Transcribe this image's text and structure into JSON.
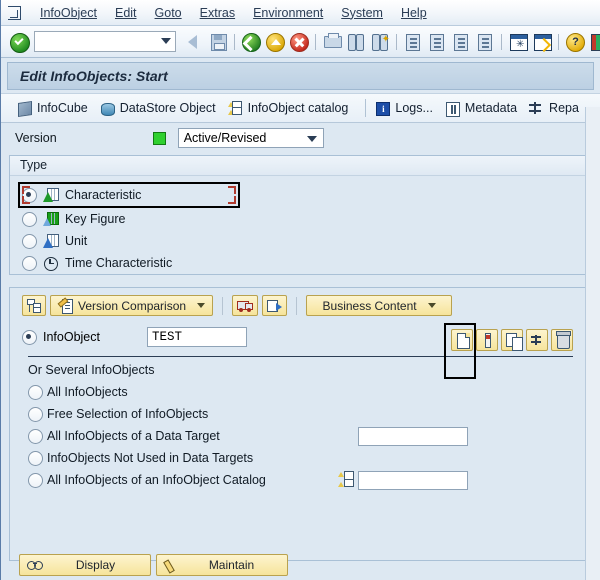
{
  "window": {
    "system_icon": "window-menu-icon"
  },
  "menubar": {
    "items": [
      {
        "label": "InfoObject",
        "accel_index": 0
      },
      {
        "label": "Edit",
        "accel_index": 0
      },
      {
        "label": "Goto",
        "accel_index": 0
      },
      {
        "label": "Extras",
        "accel_index": 4
      },
      {
        "label": "Environment",
        "accel_index": 2
      },
      {
        "label": "System",
        "accel_index": 1
      },
      {
        "label": "Help",
        "accel_index": 0
      }
    ]
  },
  "toolbar": {
    "command_field_value": "",
    "icons": [
      "enter-check-icon",
      "back-arrow-icon",
      "save-icon",
      "back-globe-icon",
      "exit-globe-icon",
      "cancel-globe-icon",
      "print-icon",
      "find-icon",
      "find-next-icon",
      "first-page-icon",
      "previous-page-icon",
      "next-page-icon",
      "last-page-icon",
      "create-session-icon",
      "create-shortcut-icon",
      "help-icon",
      "customize-local-layout-icon"
    ]
  },
  "title": {
    "text": "Edit InfoObjects: Start"
  },
  "apptoolbar": {
    "buttons": [
      {
        "label": "InfoCube",
        "icon": "infocube-icon"
      },
      {
        "label": "DataStore Object",
        "icon": "datastore-object-icon"
      },
      {
        "label": "InfoObject catalog",
        "icon": "infoobject-catalog-icon"
      },
      {
        "label": "Logs...",
        "icon": "logs-icon"
      },
      {
        "label": "Metadata",
        "icon": "metadata-icon"
      },
      {
        "label": "Repa",
        "icon": "repair-icon"
      }
    ]
  },
  "version": {
    "label": "Version",
    "status_color": "#2fd02f",
    "selected": "Active/Revised"
  },
  "type_group": {
    "title": "Type",
    "options": [
      {
        "label": "Characteristic",
        "selected": true,
        "icon": "characteristic-icon",
        "highlighted": true
      },
      {
        "label": "Key Figure",
        "selected": false,
        "icon": "key-figure-icon",
        "highlighted": false
      },
      {
        "label": "Unit",
        "selected": false,
        "icon": "unit-icon",
        "highlighted": false
      },
      {
        "label": "Time Characteristic",
        "selected": false,
        "icon": "time-characteristic-icon",
        "highlighted": false
      }
    ]
  },
  "actions": {
    "hierarchy_icon": "hierarchy-icon",
    "version_comparison": "Version Comparison",
    "truck_icon": "transport-truck-icon",
    "transport_icon": "transport-connection-icon",
    "business_content": "Business Content"
  },
  "single": {
    "radio_label": "InfoObject",
    "radio_selected": true,
    "input_value": "TEST",
    "icon_buttons": [
      {
        "icon": "create-page-icon",
        "highlighted": true
      },
      {
        "icon": "change-pencil-icon",
        "highlighted": false
      },
      {
        "icon": "copy-icon",
        "highlighted": false
      },
      {
        "icon": "repair-wrench-icon",
        "highlighted": false
      },
      {
        "icon": "delete-trash-icon",
        "highlighted": false
      }
    ]
  },
  "several": {
    "heading": "Or Several InfoObjects",
    "options": [
      {
        "label": "All InfoObjects",
        "selected": false,
        "has_input": false,
        "input_value": "",
        "icon": ""
      },
      {
        "label": "Free Selection of InfoObjects",
        "selected": false,
        "has_input": false,
        "input_value": "",
        "icon": ""
      },
      {
        "label": "All InfoObjects of a Data Target",
        "selected": false,
        "has_input": true,
        "input_value": "",
        "icon": ""
      },
      {
        "label": "InfoObjects Not Used in Data Targets",
        "selected": false,
        "has_input": false,
        "input_value": "",
        "icon": ""
      },
      {
        "label": "All InfoObjects of an InfoObject Catalog",
        "selected": false,
        "has_input": true,
        "input_value": "",
        "icon": "infoobject-catalog-icon"
      }
    ]
  },
  "footer": {
    "display": "Display",
    "maintain": "Maintain"
  }
}
